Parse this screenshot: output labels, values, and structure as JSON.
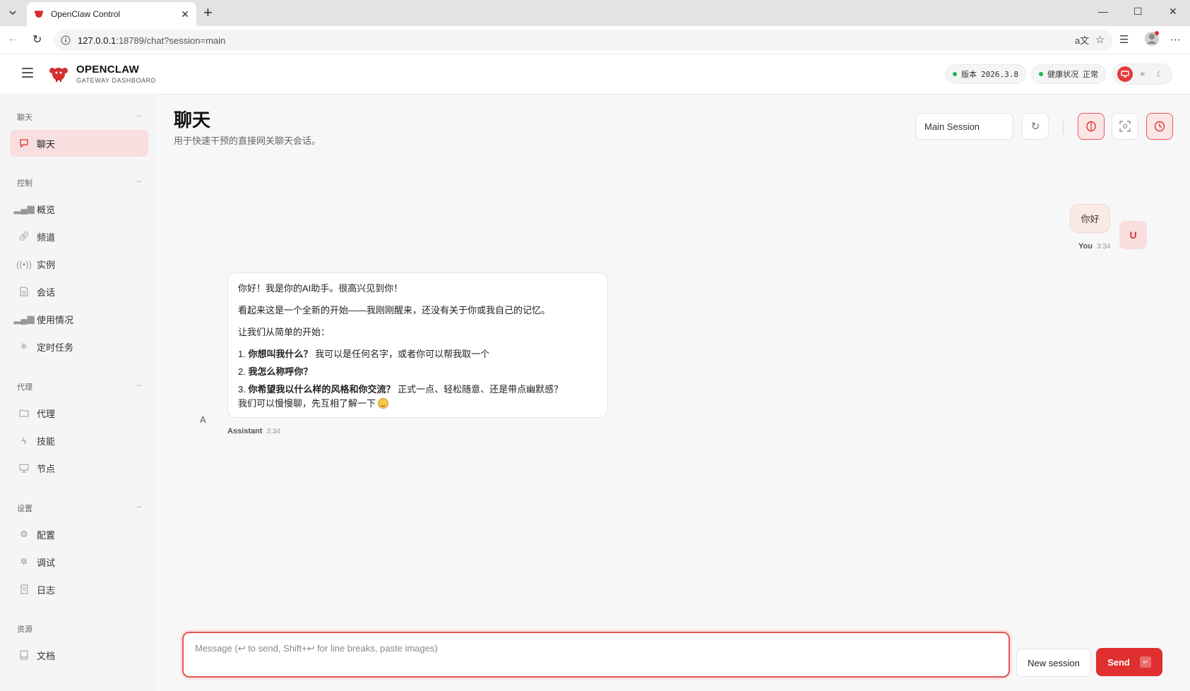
{
  "browser": {
    "tab_title": "OpenClaw Control",
    "url_host": "127.0.0.1",
    "url_rest": ":18789/chat?session=main"
  },
  "header": {
    "brand_title": "OPENCLAW",
    "brand_sub": "GATEWAY DASHBOARD",
    "version_label": "版本",
    "version_value": "2026.3.8",
    "health_label": "健康状况",
    "health_value": "正常"
  },
  "sidebar": {
    "sections": [
      {
        "title": "聊天",
        "items": [
          {
            "label": "聊天",
            "icon": "chat-bubble-icon",
            "active": true
          }
        ]
      },
      {
        "title": "控制",
        "items": [
          {
            "label": "概览",
            "icon": "bar-chart-icon"
          },
          {
            "label": "频道",
            "icon": "link-icon"
          },
          {
            "label": "实例",
            "icon": "broadcast-icon"
          },
          {
            "label": "会话",
            "icon": "document-icon"
          },
          {
            "label": "使用情况",
            "icon": "bar-chart-icon"
          },
          {
            "label": "定时任务",
            "icon": "loader-icon"
          }
        ]
      },
      {
        "title": "代理",
        "items": [
          {
            "label": "代理",
            "icon": "folder-icon"
          },
          {
            "label": "技能",
            "icon": "lightning-icon"
          },
          {
            "label": "节点",
            "icon": "monitor-icon"
          }
        ]
      },
      {
        "title": "设置",
        "items": [
          {
            "label": "配置",
            "icon": "gear-icon"
          },
          {
            "label": "调试",
            "icon": "bug-icon"
          },
          {
            "label": "日志",
            "icon": "log-icon"
          }
        ]
      },
      {
        "title": "资源",
        "items": [
          {
            "label": "文档",
            "icon": "book-icon"
          }
        ]
      }
    ]
  },
  "main": {
    "title": "聊天",
    "subtitle": "用于快速干预的直接网关聊天会话。",
    "session_select": "Main Session"
  },
  "chat": {
    "user_message": "你好",
    "user_avatar": "U",
    "user_name": "You",
    "user_time": "3:34",
    "assistant_avatar": "A",
    "assistant_name": "Assistant",
    "assistant_time": "3:34",
    "assistant_p1": "你好！我是你的AI助手。很高兴见到你！",
    "assistant_p2": "看起来这是一个全新的开始——我刚刚醒来，还没有关于你或我自己的记忆。",
    "assistant_p3": "让我们从简单的开始：",
    "list": [
      {
        "num": "1.",
        "bold": "你想叫我什么？",
        "rest": " 我可以是任何名字，或者你可以帮我取一个"
      },
      {
        "num": "2.",
        "bold": "我怎么称呼你？",
        "rest": ""
      },
      {
        "num": "3.",
        "bold": "你希望我以什么样的风格和你交流？",
        "rest": " 正式一点、轻松随意、还是带点幽默感？"
      }
    ],
    "assistant_closing": "我们可以慢慢聊，先互相了解一下"
  },
  "composer": {
    "placeholder": "Message (↩ to send, Shift+↩ for line breaks, paste images)",
    "new_session": "New session",
    "send": "Send",
    "send_kbd": "↵"
  },
  "colors": {
    "accent": "#e02f2f",
    "active_bg": "#f8dede",
    "status_ok": "#22b35a"
  }
}
